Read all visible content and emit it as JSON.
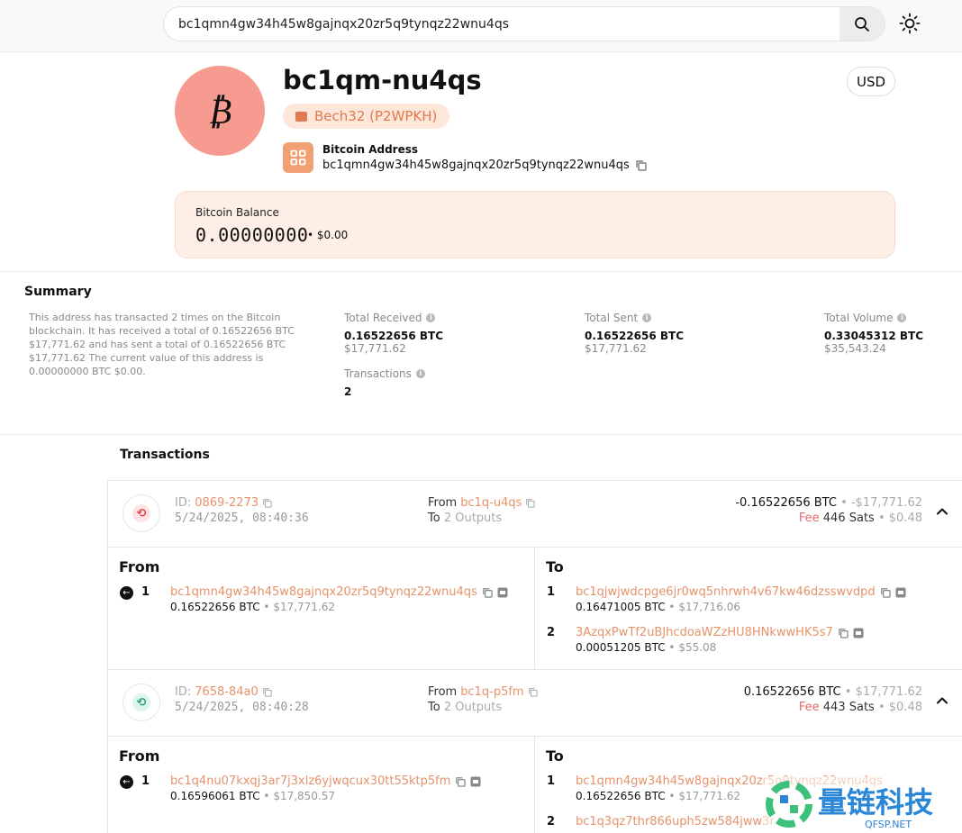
{
  "search": {
    "value": "bc1qmn4gw34h45w8gajnqx20zr5q9tynqz22wnu4qs"
  },
  "profile": {
    "avatar_glyph": "₿",
    "short_address": "bc1qm-nu4qs",
    "address_type": "Bech32 (P2WPKH)",
    "address_label": "Bitcoin Address",
    "full_address": "bc1qmn4gw34h45w8gajnqx20zr5q9tynqz22wnu4qs",
    "currency": "USD"
  },
  "balance": {
    "label": "Bitcoin Balance",
    "btc": "0.00000000",
    "fiat": "• $0.00"
  },
  "summary": {
    "title": "Summary",
    "description": "This address has transacted 2 times on the Bitcoin blockchain. It has received a total of 0.16522656 BTC $17,771.62 and has sent a total of 0.16522656 BTC $17,771.62 The current value of this address is 0.00000000 BTC $0.00.",
    "total_received": {
      "label": "Total Received",
      "btc": "0.16522656 BTC",
      "fiat": "$17,771.62"
    },
    "total_sent": {
      "label": "Total Sent",
      "btc": "0.16522656 BTC",
      "fiat": "$17,771.62"
    },
    "total_volume": {
      "label": "Total Volume",
      "btc": "0.33045312 BTC",
      "fiat": "$35,543.24"
    },
    "transactions": {
      "label": "Transactions",
      "value": "2"
    }
  },
  "transactions_title": "Transactions",
  "transactions": [
    {
      "id_label": "ID:",
      "id": "0869-2273",
      "date": "5/24/2025, 08:40:36",
      "from_label": "From",
      "from": "bc1q-u4qs",
      "to_label": "To",
      "to": "2 Outputs",
      "amount": "-0.16522656 BTC",
      "amount_fiat": "• -$17,771.62",
      "fee_label": "Fee",
      "fee_sats": "446 Sats",
      "fee_fiat": "• $0.48",
      "icon_color": "#e04848",
      "icon_bg": "#fde3e3",
      "from_col": "From",
      "to_col": "To",
      "inputs": [
        {
          "n": "1",
          "address": "bc1qmn4gw34h45w8gajnqx20zr5q9tynqz22wnu4qs",
          "btc": "0.16522656 BTC",
          "fiat": "• $17,771.62"
        }
      ],
      "outputs": [
        {
          "n": "1",
          "address": "bc1qjwjwdcpge6jr0wq5nhrwh4v67kw46dzsswvdpd",
          "btc": "0.16471005 BTC",
          "fiat": "• $17,716.06"
        },
        {
          "n": "2",
          "address": "3AzqxPwTf2uBJhcdoaWZzHU8HNkwwHK5s7",
          "btc": "0.00051205 BTC",
          "fiat": "• $55.08"
        }
      ]
    },
    {
      "id_label": "ID:",
      "id": "7658-84a0",
      "date": "5/24/2025, 08:40:28",
      "from_label": "From",
      "from": "bc1q-p5fm",
      "to_label": "To",
      "to": "2 Outputs",
      "amount": "0.16522656 BTC",
      "amount_fiat": "• $17,771.62",
      "fee_label": "Fee",
      "fee_sats": "443 Sats",
      "fee_fiat": "• $0.48",
      "icon_color": "#2e9e7a",
      "icon_bg": "#def3ec",
      "from_col": "From",
      "to_col": "To",
      "inputs": [
        {
          "n": "1",
          "address": "bc1q4nu07kxqj3ar7j3xlz6yjwqcux30tt55ktp5fm",
          "btc": "0.16596061 BTC",
          "fiat": "• $17,850.57"
        }
      ],
      "outputs": [
        {
          "n": "1",
          "address": "bc1qmn4gw34h45w8gajnqx20zr5q9tynqz22wnu4qs",
          "btc": "0.16522656 BTC",
          "fiat": "• $17,771.62"
        },
        {
          "n": "2",
          "address": "bc1q3qz7thr866uph5zw584jww3r",
          "btc": "",
          "fiat": ""
        }
      ]
    }
  ],
  "watermark": {
    "text": "量链科技",
    "sub": "QFSP.NET",
    "colors": {
      "green": "#3cc07a",
      "blue": "#2a86d6"
    }
  },
  "colors": {
    "accent": "#e5936a",
    "avatar": "#f79a8f",
    "balance_bg": "#fdeee6",
    "fee": "#e06a6a"
  }
}
